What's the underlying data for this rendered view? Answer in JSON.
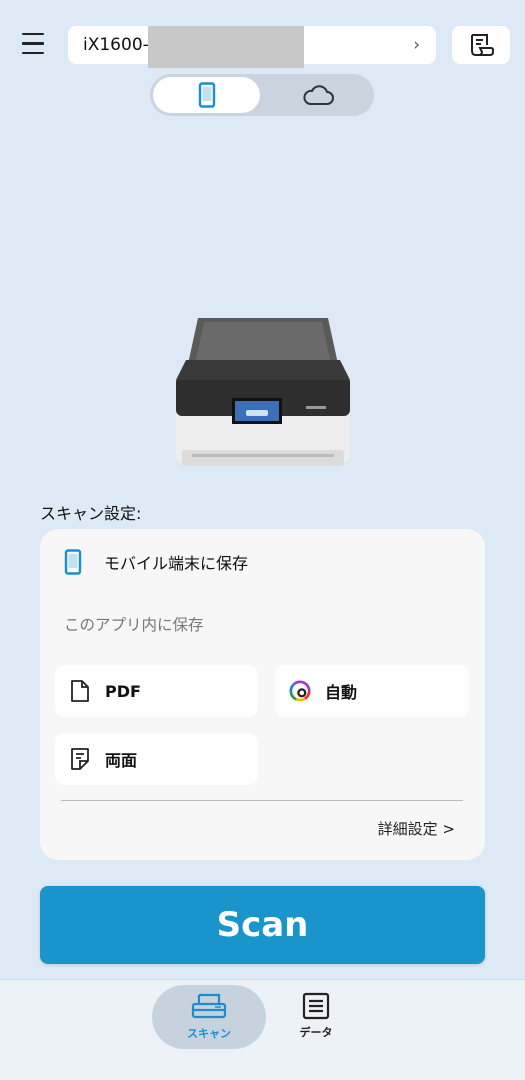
{
  "header": {
    "device_name": "iX1600-",
    "menu_icon": "hamburger-icon",
    "receipt_icon": "receipt-icon"
  },
  "destination_toggle": {
    "options": [
      {
        "name": "mobile",
        "icon": "smartphone-icon",
        "selected": true
      },
      {
        "name": "cloud",
        "icon": "cloud-icon",
        "selected": false
      }
    ]
  },
  "settings": {
    "section_label": "スキャン設定:",
    "save_destination": "モバイル端末に保存",
    "save_subtext": "このアプリ内に保存",
    "file_format": "PDF",
    "color_mode": "自動",
    "scan_side": "両面",
    "advanced_link": "詳細設定 >"
  },
  "scan_button": {
    "label": "Scan"
  },
  "bottom_nav": {
    "items": [
      {
        "label": "スキャン",
        "icon": "scanner-icon",
        "active": true
      },
      {
        "label": "データ",
        "icon": "document-list-icon",
        "active": false
      }
    ]
  },
  "colors": {
    "background": "#dde9f4",
    "accent": "#1995cc",
    "card": "#f7f7f7"
  }
}
